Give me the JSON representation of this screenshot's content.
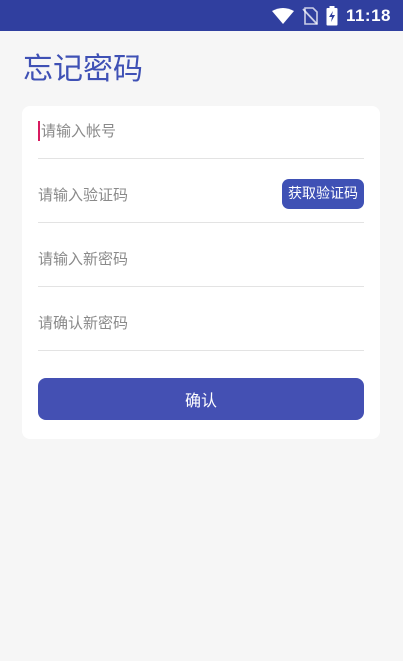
{
  "status_bar": {
    "time": "11:18",
    "icons": [
      "wifi-icon",
      "no-sim-icon",
      "battery-charging-icon"
    ]
  },
  "page": {
    "title": "忘记密码"
  },
  "form": {
    "account_placeholder": "请输入帐号",
    "code_placeholder": "请输入验证码",
    "get_code_label": "获取验证码",
    "new_password_placeholder": "请输入新密码",
    "confirm_password_placeholder": "请确认新密码",
    "confirm_label": "确认"
  },
  "colors": {
    "status_bar": "#303f9f",
    "accent": "#3f51b5",
    "button": "#4450b3",
    "background": "#f6f6f6",
    "cursor": "#d81b60"
  }
}
